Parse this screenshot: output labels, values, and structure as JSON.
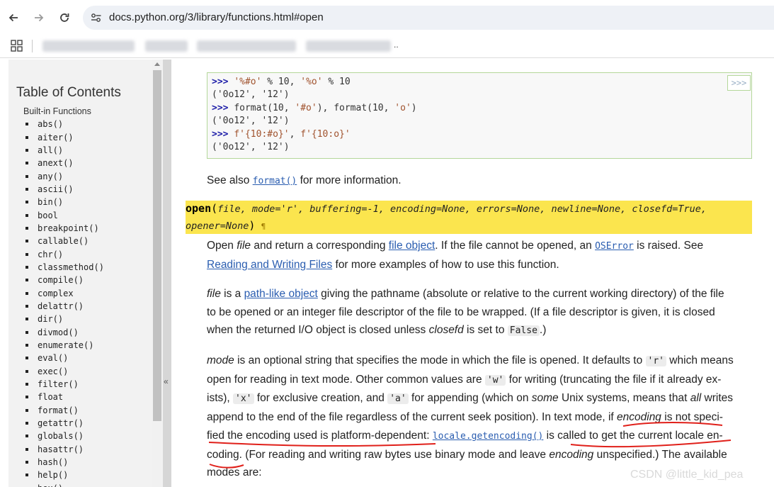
{
  "browser": {
    "url": "docs.python.org/3/library/functions.html#open",
    "bookmarks_more": ".."
  },
  "sidebar": {
    "title": "Table of Contents",
    "subtitle": "Built-in Functions",
    "items": [
      "abs()",
      "aiter()",
      "all()",
      "anext()",
      "any()",
      "ascii()",
      "bin()",
      "bool",
      "breakpoint()",
      "callable()",
      "chr()",
      "classmethod()",
      "compile()",
      "complex",
      "delattr()",
      "dir()",
      "divmod()",
      "enumerate()",
      "eval()",
      "exec()",
      "filter()",
      "float",
      "format()",
      "getattr()",
      "globals()",
      "hasattr()",
      "hash()",
      "help()",
      "hex()"
    ],
    "collapse_symbol": "«"
  },
  "code_example": {
    "copy_label": ">>>",
    "lines": [
      {
        "prompt": ">>> ",
        "s1": "'%#o'",
        "m1": " % 10, ",
        "s2": "'%o'",
        "m2": " % 10"
      },
      {
        "out": "('0o12', '12')"
      },
      {
        "prompt": ">>> ",
        "m0": "format(10, ",
        "s1": "'#o'",
        "m1": "), format(10, ",
        "s2": "'o'",
        "m2": ")"
      },
      {
        "out": "('0o12', '12')"
      },
      {
        "prompt": ">>> ",
        "s1": "f'{10:#o}'",
        "m1": ", ",
        "s2": "f'{10:o}'",
        "m2": ""
      },
      {
        "out": "('0o12', '12')"
      }
    ]
  },
  "see_also": {
    "pre": "See also ",
    "link": "format()",
    "post": " for more information."
  },
  "signature": {
    "name": "open",
    "params_line1": "file, mode='r', buffering=-1, encoding=None, errors=None, newline=None, closefd=True,",
    "params_line2": "opener=None",
    "open_paren": "(",
    "close_paren": ")",
    "anchor": "¶"
  },
  "para1": {
    "a": "Open ",
    "file": "file",
    "b": " and return a corresponding ",
    "link1": "file object",
    "c": ". If the file cannot be opened, an ",
    "code1": "OSError",
    "d": " is raised. See",
    "link2": "Reading and Writing Files",
    "e": " for more examples of how to use this function."
  },
  "para2": {
    "file": "file",
    "a": " is a ",
    "link1": "path-like object",
    "b": " giving the pathname (absolute or relative to the current working directory) of the file",
    "line2": "to be opened or an integer file descriptor of the file to be wrapped. (If a file descriptor is given, it is closed",
    "c": "when the returned I/O object is closed unless ",
    "closefd": "closefd",
    "d": " is set to ",
    "code1": "False",
    "e": ".)"
  },
  "para3": {
    "mode": "mode",
    "a": " is an optional string that specifies the mode in which the file is opened. It defaults to ",
    "code_r": "'r'",
    "b": " which means",
    "c": "open for reading in text mode. Other common values are ",
    "code_w": "'w'",
    "d": " for writing (truncating the file if it already ex-",
    "e": "ists), ",
    "code_x": "'x'",
    "f": " for exclusive creation, and ",
    "code_a": "'a'",
    "g": " for appending (which on ",
    "some": "some",
    "h": " Unix systems, means that ",
    "all": "all",
    "i": " writes",
    "j": "append to the end of the file regardless of the current seek position). In text mode, if ",
    "encoding1": "encoding",
    "k": " is not speci-",
    "l": "fied the encoding used is platform-dependent: ",
    "code_locale": "locale.getencoding()",
    "m": " is called to get the current locale en-",
    "n": "coding. (For reading and writing raw bytes use binary mode and leave ",
    "encoding2": "encoding",
    "o": " unspecified.) The available",
    "p": "modes are:"
  },
  "watermark": "CSDN @little_kid_pea",
  "colors": {
    "signature_bg": "#fbe54e",
    "link": "#2a5db0",
    "annotation": "#e0201a",
    "code_border": "#b4d79a"
  }
}
